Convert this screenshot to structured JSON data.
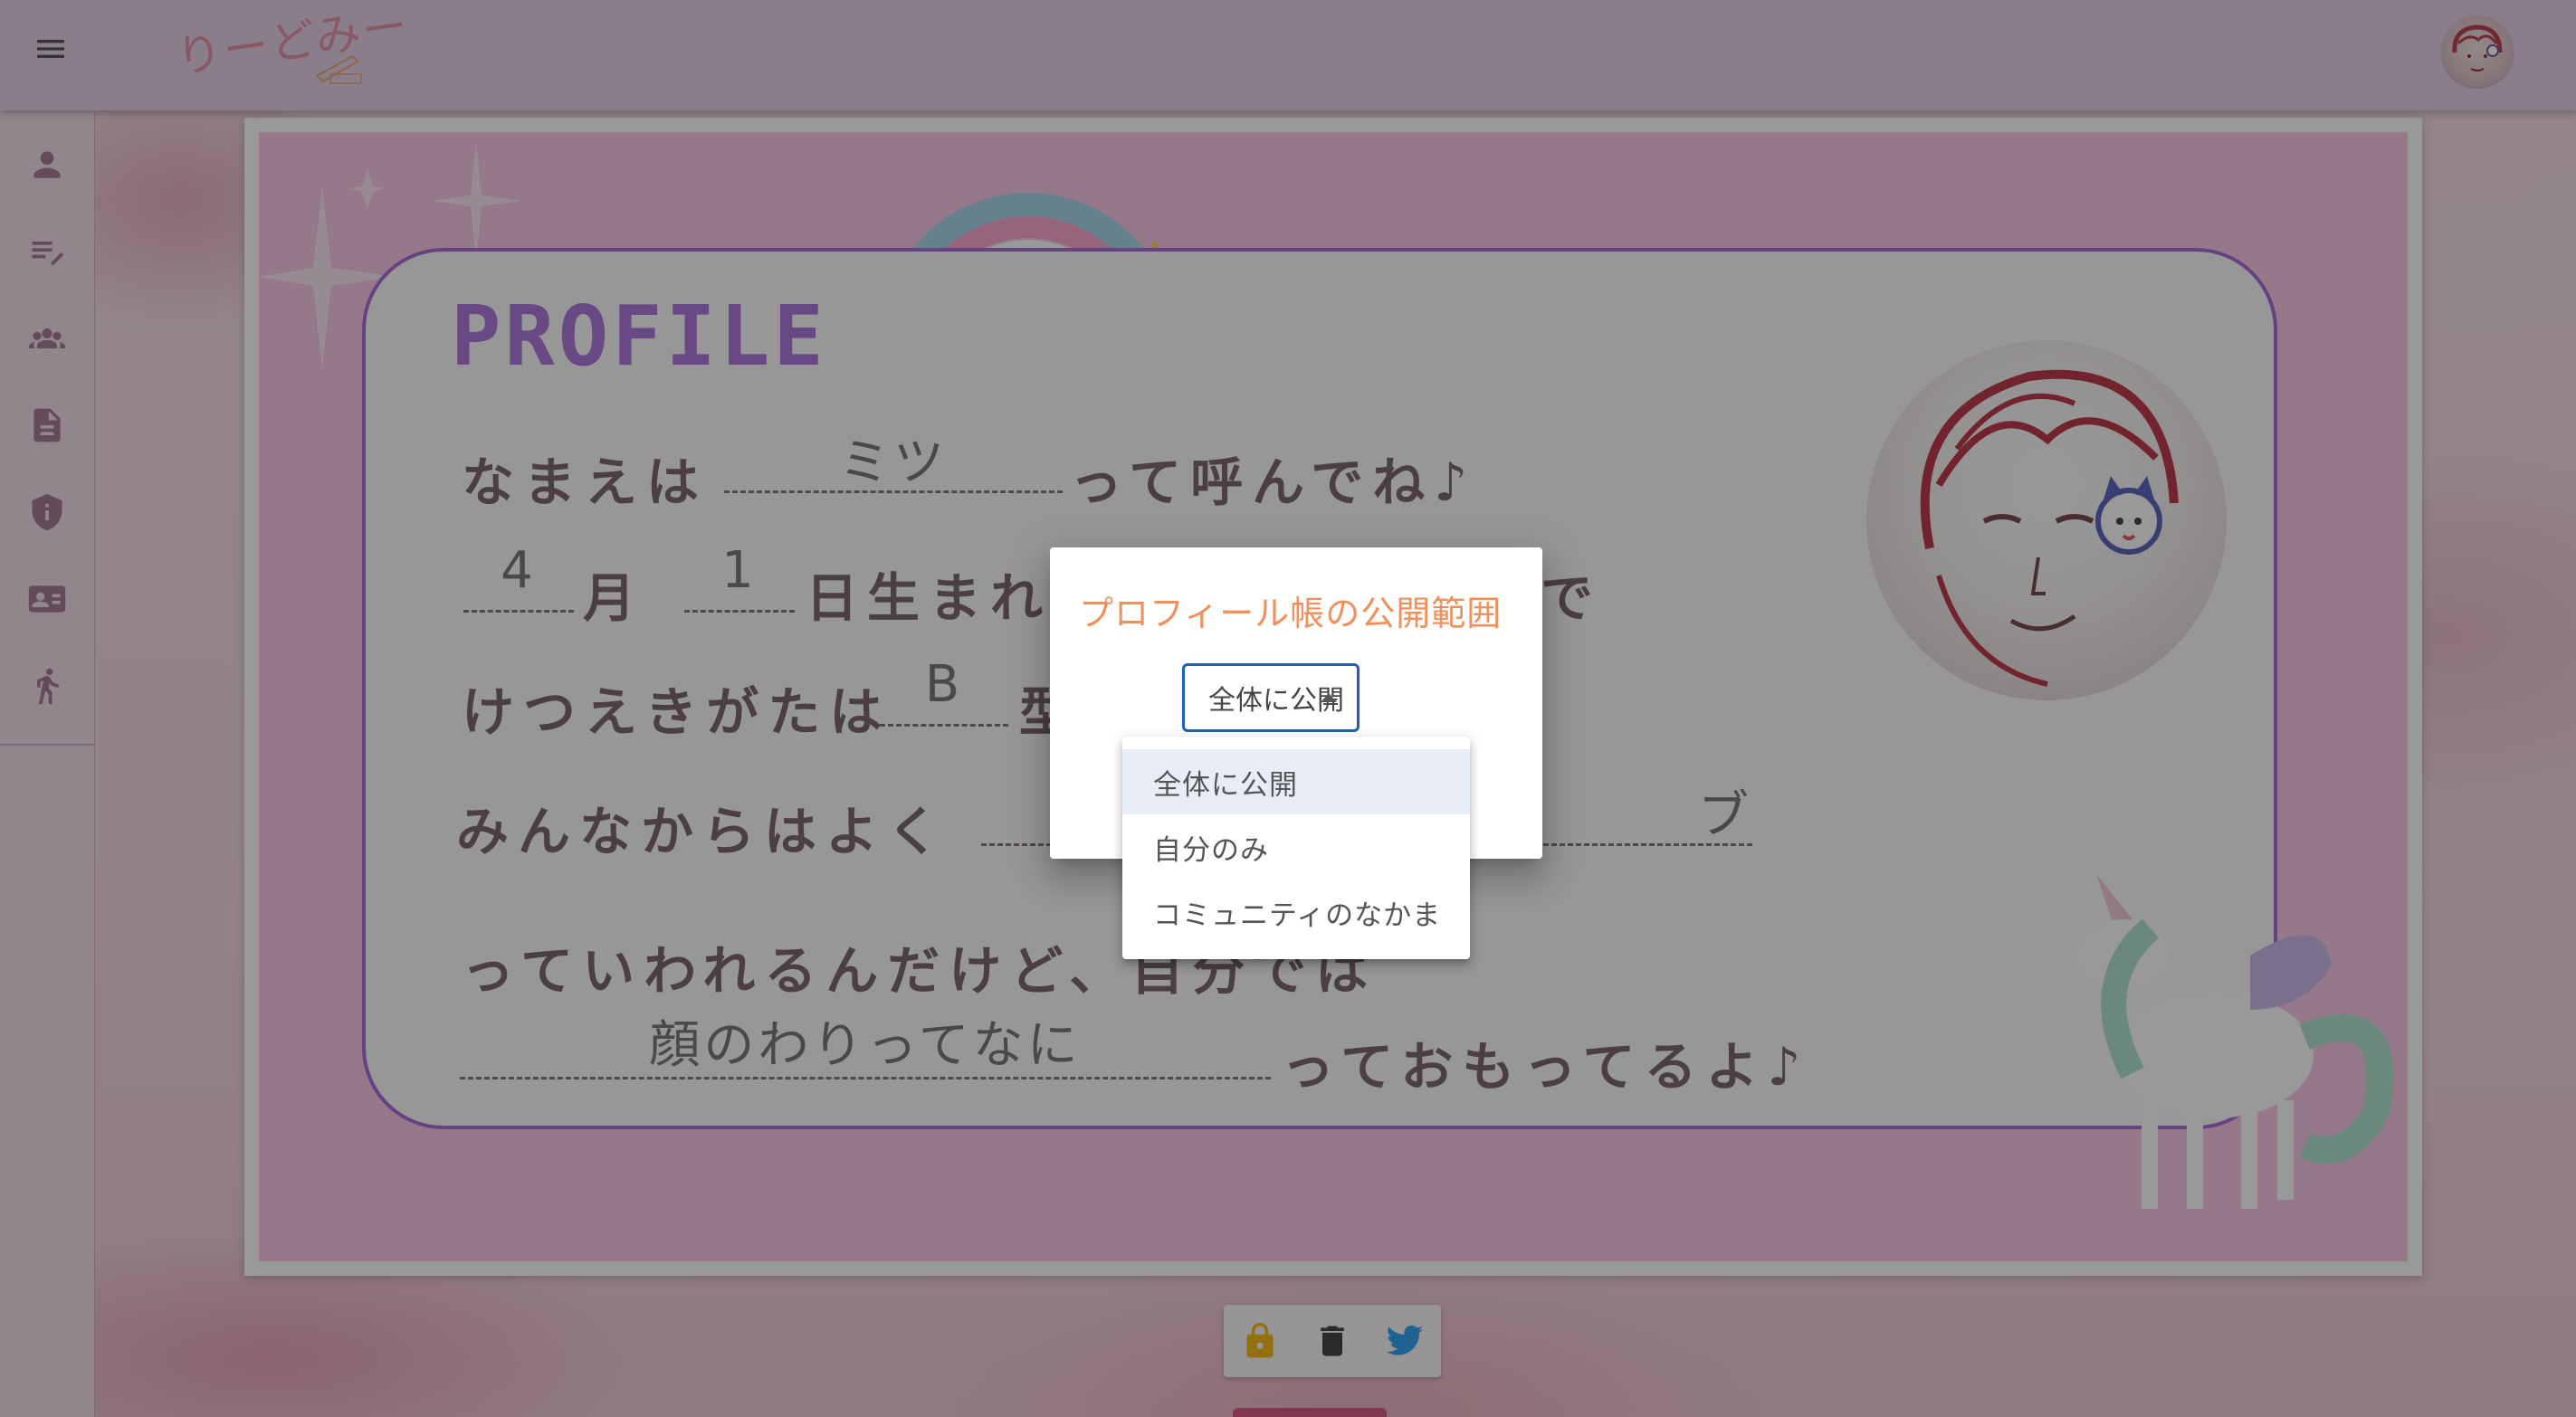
{
  "app": {
    "logo_text": "りーどみー",
    "menu_icon": "menu-icon"
  },
  "rail": {
    "items": [
      {
        "icon": "person-icon"
      },
      {
        "icon": "edit-list-icon"
      },
      {
        "icon": "group-icon"
      },
      {
        "icon": "document-icon"
      },
      {
        "icon": "shield-icon"
      },
      {
        "icon": "contact-card-icon"
      },
      {
        "icon": "running-icon"
      }
    ]
  },
  "profile": {
    "title": "PROFILE",
    "line1_prefix": "なまえは",
    "name": "ミツ",
    "line1_suffix": "って呼んでね♪",
    "month": "4",
    "month_label": "月",
    "day": "1",
    "line2_suffix": "日生まれ",
    "line2_end": "で",
    "line3_prefix": "けつえきがたは",
    "blood_type": "B",
    "line3_suffix": "型",
    "line4_prefix": "みんなからはよく",
    "nickname_partial": "ブ",
    "line5": "っていわれるんだけど、自分では",
    "self_view": "顔のわりってなに",
    "line6_suffix": "っておもってるよ♪"
  },
  "dialog": {
    "title": "プロフィール帳の公開範囲",
    "selected": "全体に公開"
  },
  "menu": {
    "options": [
      "全体に公開",
      "自分のみ",
      "コミュニティのなかま"
    ],
    "selected_index": 0
  },
  "actions": {
    "lock_icon": "lock-icon",
    "delete_icon": "trash-icon",
    "share_icon": "twitter-icon"
  },
  "colors": {
    "appbar": "#e6cde6",
    "card_pink": "#f7c2e4",
    "frame_purple": "#9f5fd3",
    "dialog_title": "#f0915c",
    "select_border": "#1f5fb4",
    "lock": "#f4b400",
    "twitter": "#1d9bf0"
  }
}
